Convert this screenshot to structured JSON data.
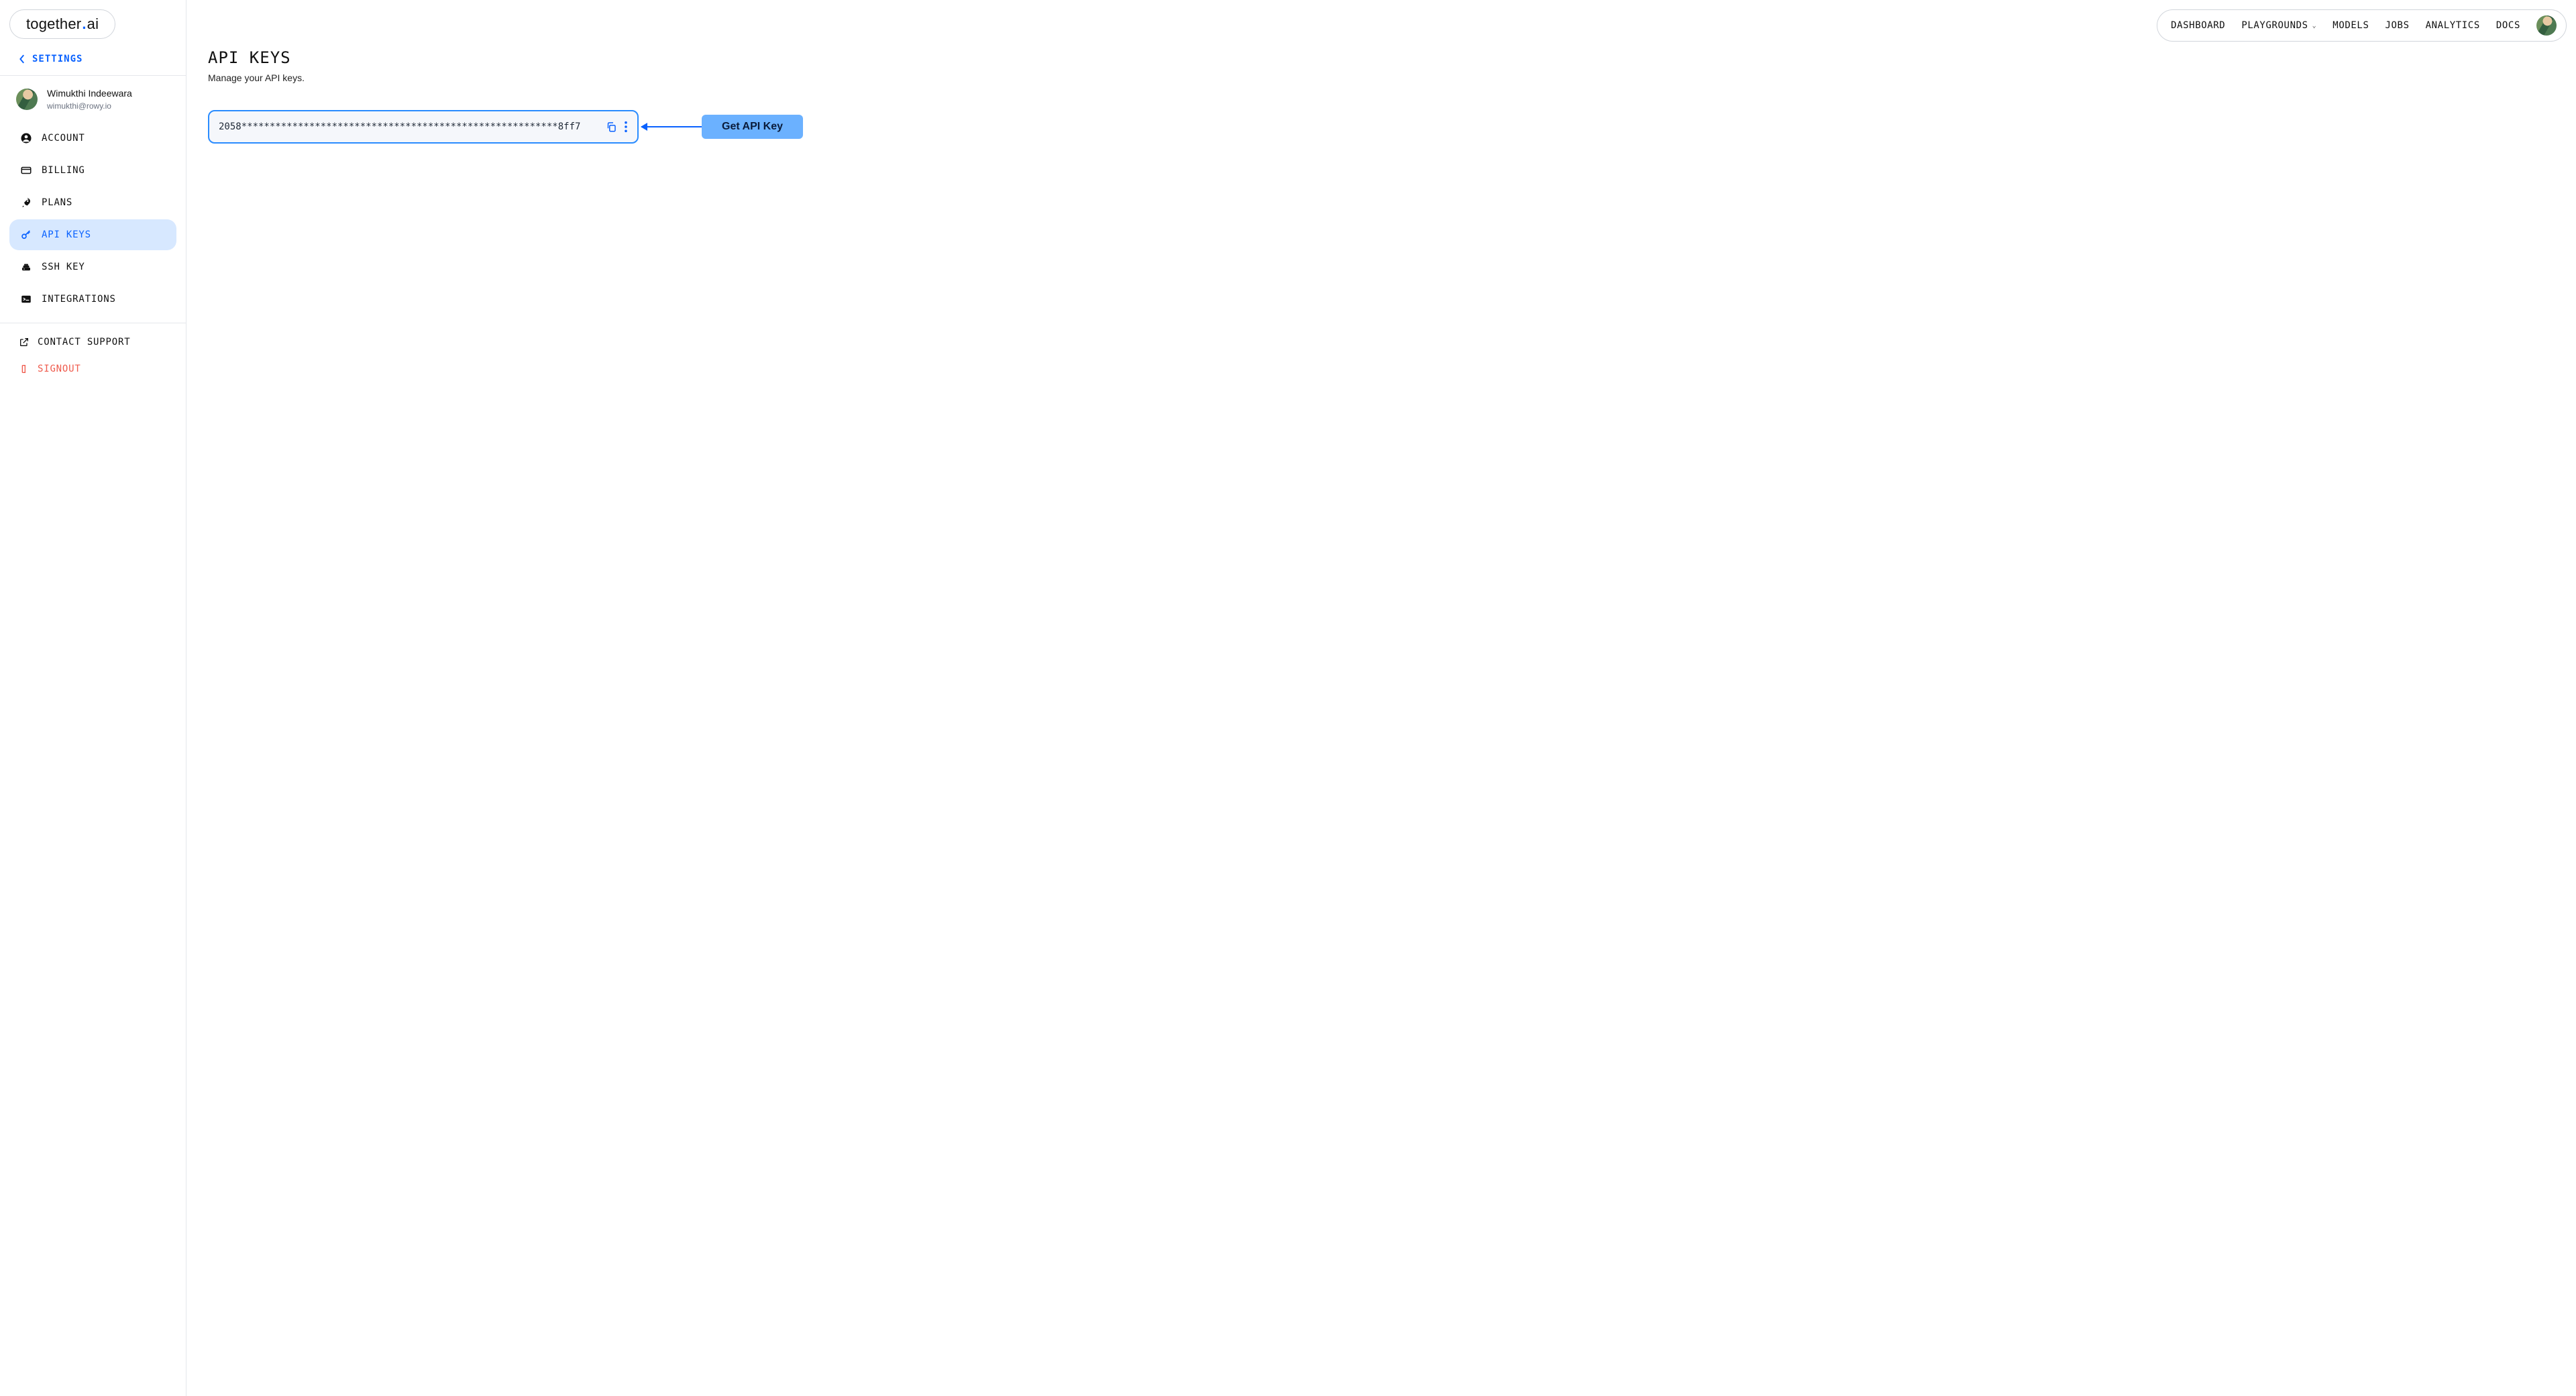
{
  "logo": {
    "left": "together",
    "right": "ai"
  },
  "sidebar": {
    "back_label": "SETTINGS",
    "user": {
      "name": "Wimukthi Indeewara",
      "email": "wimukthi@rowy.io"
    },
    "items": [
      {
        "label": "ACCOUNT"
      },
      {
        "label": "BILLING"
      },
      {
        "label": "PLANS"
      },
      {
        "label": "API KEYS"
      },
      {
        "label": "SSH KEY"
      },
      {
        "label": "INTEGRATIONS"
      }
    ],
    "active_index": 3,
    "bottom": {
      "support": "CONTACT SUPPORT",
      "signout": "SIGNOUT"
    }
  },
  "topnav": {
    "items": [
      {
        "label": "DASHBOARD",
        "dropdown": false
      },
      {
        "label": "PLAYGROUNDS",
        "dropdown": true
      },
      {
        "label": "MODELS",
        "dropdown": false
      },
      {
        "label": "JOBS",
        "dropdown": false
      },
      {
        "label": "ANALYTICS",
        "dropdown": false
      },
      {
        "label": "DOCS",
        "dropdown": false
      }
    ]
  },
  "page": {
    "title": "API KEYS",
    "subtitle": "Manage your API keys.",
    "key_masked": "2058********************************************************8ff7",
    "callout": "Get API Key"
  }
}
